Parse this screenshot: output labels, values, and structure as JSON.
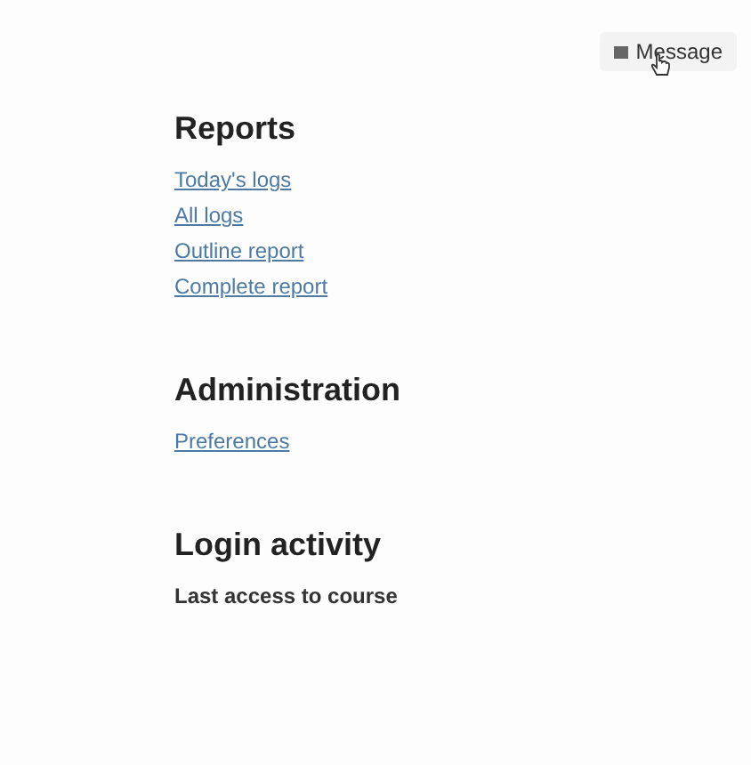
{
  "message_button": {
    "label": "Message"
  },
  "sections": [
    {
      "title": "Reports",
      "items": [
        {
          "kind": "link",
          "text": "Today's logs"
        },
        {
          "kind": "link",
          "text": "All logs"
        },
        {
          "kind": "link",
          "text": "Outline report"
        },
        {
          "kind": "link",
          "text": "Complete report"
        }
      ]
    },
    {
      "title": "Administration",
      "items": [
        {
          "kind": "link",
          "text": "Preferences"
        }
      ]
    },
    {
      "title": "Login activity",
      "items": [
        {
          "kind": "label",
          "text": "Last access to course"
        }
      ]
    }
  ]
}
